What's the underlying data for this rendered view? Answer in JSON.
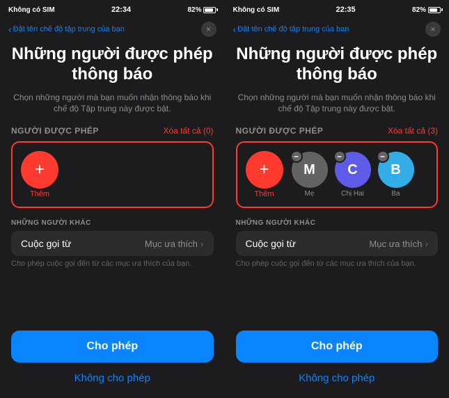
{
  "screen1": {
    "status": {
      "left": "Không có SIM",
      "time": "22:34",
      "battery": "82%"
    },
    "nav": {
      "back_label": "Đặt tên chế độ tập trung của bạn",
      "close_label": "×"
    },
    "main_title": "Những người được phép thông báo",
    "subtitle": "Chọn những người mà bạn muốn nhận thông báo khi chế độ Tập trung này được bật.",
    "section_label": "Người được phép",
    "section_action": "Xóa tất cả (0)",
    "add_label": "Thêm",
    "others_label": "NHỮNG NGƯỜI KHÁC",
    "option1_label": "Cuộc gọi từ",
    "option1_value": "Mục ưa thích",
    "option1_desc": "Cho phép cuộc gọi đến từ các mục ưa thích của bạn.",
    "allow_btn": "Cho phép",
    "deny_btn": "Không cho phép"
  },
  "screen2": {
    "status": {
      "left": "Không có SIM",
      "time": "22:35",
      "battery": "82%"
    },
    "nav": {
      "back_label": "Đặt tên chế độ tập trung của bạn",
      "close_label": "×"
    },
    "main_title": "Những người được phép thông báo",
    "subtitle": "Chọn những người mà bạn muốn nhận thông báo khi chế độ Tập trung này được bật.",
    "section_label": "Người được phép",
    "section_action": "Xóa tất cả (3)",
    "add_label": "Thêm",
    "contacts": [
      {
        "initial": "M",
        "name": "Mẹ",
        "color": "gray"
      },
      {
        "initial": "C",
        "name": "Chị Hai",
        "color": "purple"
      },
      {
        "initial": "B",
        "name": "Ba",
        "color": "teal"
      }
    ],
    "others_label": "NHỮNG NGƯỜI KHÁC",
    "option1_label": "Cuộc gọi từ",
    "option1_value": "Mục ưa thích",
    "option1_desc": "Cho phép cuộc gọi đến từ các mục ưa thích của bạn.",
    "allow_btn": "Cho phép",
    "deny_btn": "Không cho phép"
  }
}
